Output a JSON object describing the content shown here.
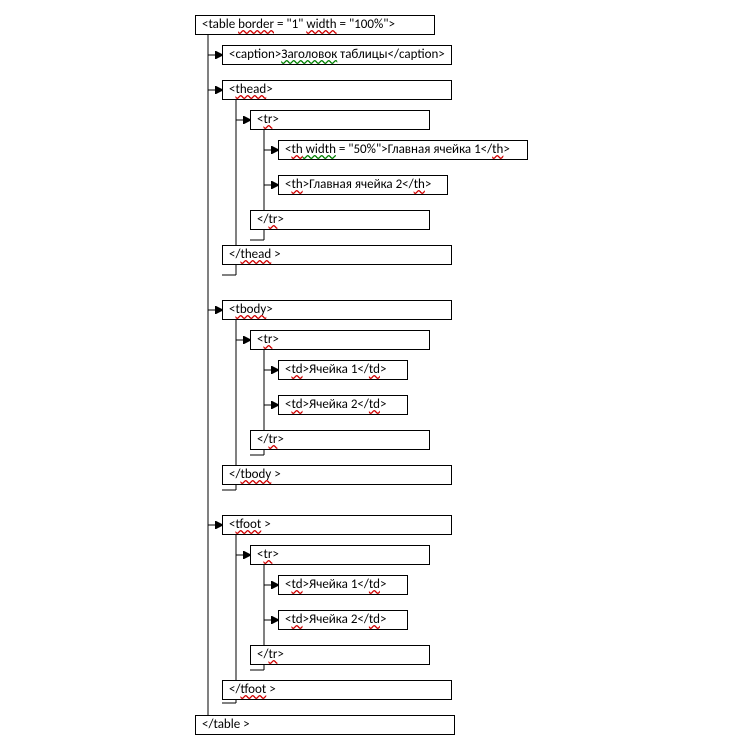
{
  "n0_a": "<table ",
  "n0_b": "border",
  "n0_c": " = \"1\" ",
  "n0_d": "width",
  "n0_e": " = \"100%\">",
  "n1_a": "<caption>",
  "n1_b": "Заголовок",
  "n1_c": " таблицы</caption>",
  "n2_a": "<",
  "n2_b": "thead",
  "n2_c": ">",
  "n3_a": "<",
  "n3_b": "tr",
  "n3_c": ">",
  "n4_a": "<",
  "n4_b": "th",
  "n4_c": " width",
  "n4_d": " = \"50%\">Главная ячейка 1</",
  "n4_e": "th",
  "n4_f": ">",
  "n5_a": "<",
  "n5_b": "th",
  "n5_c": ">Главная ячейка 2</",
  "n5_d": "th",
  "n5_e": ">",
  "n6_a": "</",
  "n6_b": "tr",
  "n6_c": ">",
  "n7_a": "</",
  "n7_b": "thead",
  "n7_c": " >",
  "n8_a": "<",
  "n8_b": "tbody",
  "n8_c": ">",
  "n9_a": "<",
  "n9_b": "tr",
  "n9_c": ">",
  "n10_a": "<",
  "n10_b": "td",
  "n10_c": ">Ячейка 1</",
  "n10_d": "td",
  "n10_e": ">",
  "n11_a": "<",
  "n11_b": "td",
  "n11_c": ">Ячейка 2</",
  "n11_d": "td",
  "n11_e": ">",
  "n12_a": "</",
  "n12_b": "tr",
  "n12_c": ">",
  "n13_a": "</",
  "n13_b": "tbody",
  "n13_c": " >",
  "n14_a": "<",
  "n14_b": "tfoot",
  "n14_c": " >",
  "n15_a": "<",
  "n15_b": "tr",
  "n15_c": ">",
  "n16_a": "<",
  "n16_b": "td",
  "n16_c": ">Ячейка 1</",
  "n16_d": "td",
  "n16_e": ">",
  "n17_a": "<",
  "n17_b": "td",
  "n17_c": ">Ячейка 2</",
  "n17_d": "td",
  "n17_e": ">",
  "n18_a": "</",
  "n18_b": "tr",
  "n18_c": ">",
  "n19_a": "</",
  "n19_b": "tfoot",
  "n19_c": " >",
  "n20": "</table >"
}
